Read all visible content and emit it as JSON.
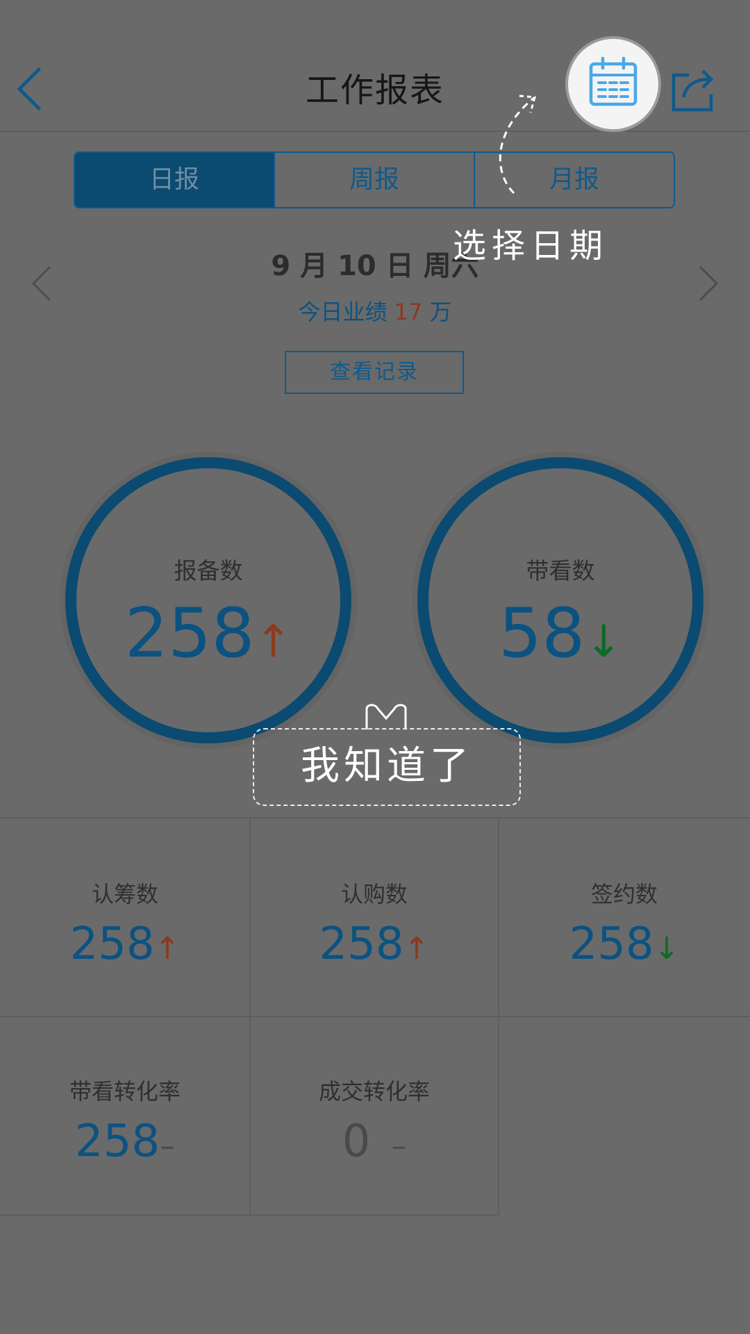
{
  "header": {
    "title": "工作报表"
  },
  "tabs": [
    {
      "label": "日报",
      "active": true
    },
    {
      "label": "周报",
      "active": false
    },
    {
      "label": "月报",
      "active": false
    }
  ],
  "date_nav": {
    "date_text": "9 月 10 日  周六",
    "performance_prefix": "今日业绩 ",
    "performance_value": "17",
    "performance_suffix": " 万"
  },
  "record_button": "查看记录",
  "rings": [
    {
      "label": "报备数",
      "value": "258",
      "trend": "↑"
    },
    {
      "label": "带看数",
      "value": "58",
      "trend": "↓"
    }
  ],
  "stats": [
    {
      "label": "认筹数",
      "value": "258",
      "trend": "↑"
    },
    {
      "label": "认购数",
      "value": "258",
      "trend": "↑"
    },
    {
      "label": "签约数",
      "value": "258",
      "trend": "↓"
    },
    {
      "label": "带看转化率",
      "value": "258",
      "trend": "–"
    },
    {
      "label": "成交转化率",
      "value": "0",
      "trend": "–"
    }
  ],
  "guide": {
    "hint": "选择日期",
    "dismiss": "我知道了"
  },
  "colors": {
    "accent": "#0e5a8c",
    "up": "#8a3a1f",
    "down": "#0e6a25",
    "calendar_icon": "#4aa8e6"
  }
}
